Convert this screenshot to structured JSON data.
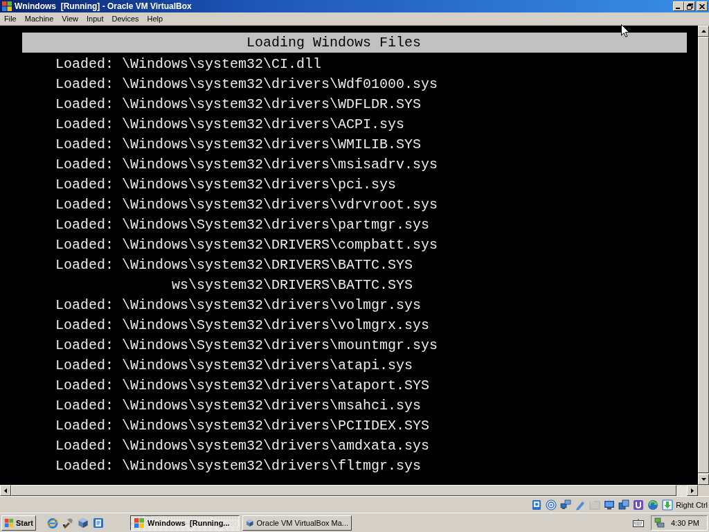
{
  "window": {
    "title": "Wnindows  [Running] - Oracle VM VirtualBox"
  },
  "menu": [
    "File",
    "Machine",
    "View",
    "Input",
    "Devices",
    "Help"
  ],
  "console": {
    "header": "Loading Windows Files",
    "lines": [
      {
        "kind": "entry",
        "text": "Loaded: \\Windows\\system32\\CI.dll"
      },
      {
        "kind": "entry",
        "text": "Loaded: \\Windows\\system32\\drivers\\Wdf01000.sys"
      },
      {
        "kind": "entry",
        "text": "Loaded: \\Windows\\system32\\drivers\\WDFLDR.SYS"
      },
      {
        "kind": "entry",
        "text": "Loaded: \\Windows\\system32\\drivers\\ACPI.sys"
      },
      {
        "kind": "entry",
        "text": "Loaded: \\Windows\\system32\\drivers\\WMILIB.SYS"
      },
      {
        "kind": "entry",
        "text": "Loaded: \\Windows\\system32\\drivers\\msisadrv.sys"
      },
      {
        "kind": "entry",
        "text": "Loaded: \\Windows\\system32\\drivers\\pci.sys"
      },
      {
        "kind": "entry",
        "text": "Loaded: \\Windows\\system32\\drivers\\vdrvroot.sys"
      },
      {
        "kind": "entry",
        "text": "Loaded: \\Windows\\System32\\drivers\\partmgr.sys"
      },
      {
        "kind": "entry",
        "text": "Loaded: \\Windows\\system32\\DRIVERS\\compbatt.sys"
      },
      {
        "kind": "entry",
        "text": "Loaded: \\Windows\\system32\\DRIVERS\\BATTC.SYS"
      },
      {
        "kind": "fragment",
        "text": "ws\\system32\\DRIVERS\\BATTC.SYS"
      },
      {
        "kind": "entry",
        "text": "Loaded: \\Windows\\system32\\drivers\\volmgr.sys"
      },
      {
        "kind": "entry",
        "text": "Loaded: \\Windows\\System32\\drivers\\volmgrx.sys"
      },
      {
        "kind": "entry",
        "text": "Loaded: \\Windows\\System32\\drivers\\mountmgr.sys"
      },
      {
        "kind": "entry",
        "text": "Loaded: \\Windows\\system32\\drivers\\atapi.sys"
      },
      {
        "kind": "entry",
        "text": "Loaded: \\Windows\\system32\\drivers\\ataport.SYS"
      },
      {
        "kind": "entry",
        "text": "Loaded: \\Windows\\system32\\drivers\\msahci.sys"
      },
      {
        "kind": "entry",
        "text": "Loaded: \\Windows\\system32\\drivers\\PCIIDEX.SYS"
      },
      {
        "kind": "entry",
        "text": "Loaded: \\Windows\\system32\\drivers\\amdxata.sys"
      },
      {
        "kind": "entry",
        "text": "Loaded: \\Windows\\system32\\drivers\\fltmgr.sys"
      }
    ]
  },
  "status_bar": {
    "devices": [
      {
        "kind": "disk",
        "disabled": false
      },
      {
        "kind": "optical",
        "disabled": false
      },
      {
        "kind": "network",
        "disabled": false
      },
      {
        "kind": "usb",
        "disabled": false
      },
      {
        "kind": "shared-folders",
        "disabled": true
      },
      {
        "kind": "display",
        "disabled": false
      },
      {
        "kind": "seamless",
        "disabled": false
      },
      {
        "kind": "mouse",
        "disabled": false
      },
      {
        "kind": "virtualization",
        "disabled": false
      },
      {
        "kind": "keyboard",
        "disabled": false
      }
    ],
    "host_key": "Right Ctrl"
  },
  "taskbar": {
    "start": "Start",
    "tasks": [
      {
        "kind": "vm",
        "label": "Wnindows  [Running...",
        "selected": true
      },
      {
        "kind": "manager",
        "label": "Oracle VM VirtualBox Ma...",
        "selected": false
      }
    ],
    "clock": "4:30 PM"
  }
}
